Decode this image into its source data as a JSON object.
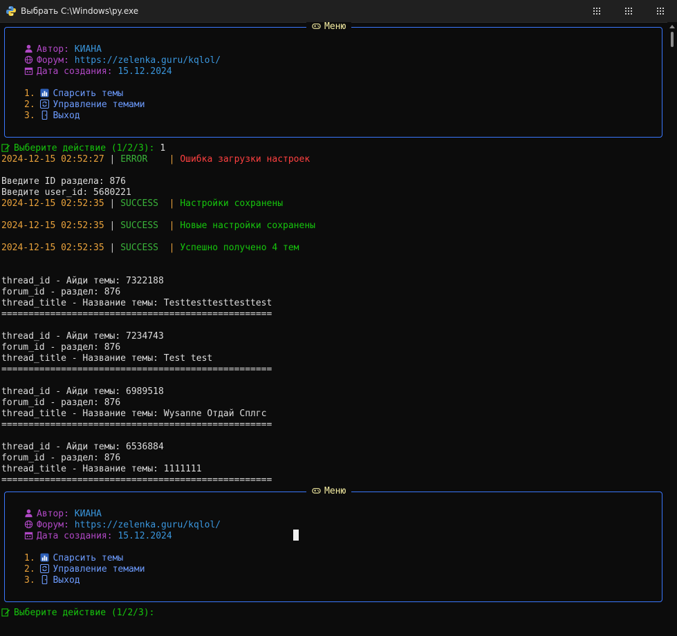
{
  "window": {
    "title": "Выбрать C:\\Windows\\py.exe"
  },
  "menu": {
    "title": "Меню",
    "author_label": "Автор:",
    "author_value": "КИАНА",
    "forum_label": "Форум:",
    "forum_value": "https://zelenka.guru/kqlol/",
    "date_label": "Дата создания:",
    "date_value": "15.12.2024",
    "items": [
      {
        "num": "1.",
        "label": "Спарсить темы",
        "icon": "bar-chart-icon"
      },
      {
        "num": "2.",
        "label": "Управление темами",
        "icon": "refresh-icon"
      },
      {
        "num": "3.",
        "label": "Выход",
        "icon": "door-icon"
      }
    ]
  },
  "prompt": {
    "text": "Выберите действие (1/2/3):",
    "answer": "1"
  },
  "logs": [
    {
      "time": "2024-12-15 02:52:27",
      "level": "ERROR  ",
      "message": "Ошибка загрузки настроек"
    },
    {
      "time": "2024-12-15 02:52:35",
      "level": "SUCCESS",
      "message": "Настройки сохранены"
    },
    {
      "time": "2024-12-15 02:52:35",
      "level": "SUCCESS",
      "message": "Новые настройки сохранены"
    },
    {
      "time": "2024-12-15 02:52:35",
      "level": "SUCCESS",
      "message": "Успешно получено 4 тем"
    }
  ],
  "inputs": {
    "section_prompt": "Введите ID раздела: 876",
    "user_prompt": "Введите user_id: 5680221"
  },
  "threads": [
    {
      "id_line": "thread_id - Айди темы: 7322188",
      "forum_line": "forum_id - раздел: 876",
      "title_line": "thread_title - Название темы: Testtesttesttesttest"
    },
    {
      "id_line": "thread_id - Айди темы: 7234743",
      "forum_line": "forum_id - раздел: 876",
      "title_line": "thread_title - Название темы: Test test"
    },
    {
      "id_line": "thread_id - Айди темы: 6989518",
      "forum_line": "forum_id - раздел: 876",
      "title_line": "thread_title - Название темы: Wysanne Отдай Сплгс"
    },
    {
      "id_line": "thread_id - Айди темы: 6536884",
      "forum_line": "forum_id - раздел: 876",
      "title_line": "thread_title - Название темы: 1111111"
    }
  ],
  "separator": "==================================================",
  "colors": {
    "border": "#3b78ff",
    "timestamp": "#e9a23b",
    "error": "#ff4040",
    "success": "#16c60c",
    "menu_label": "#b148c6",
    "menu_value": "#3a96dd"
  }
}
